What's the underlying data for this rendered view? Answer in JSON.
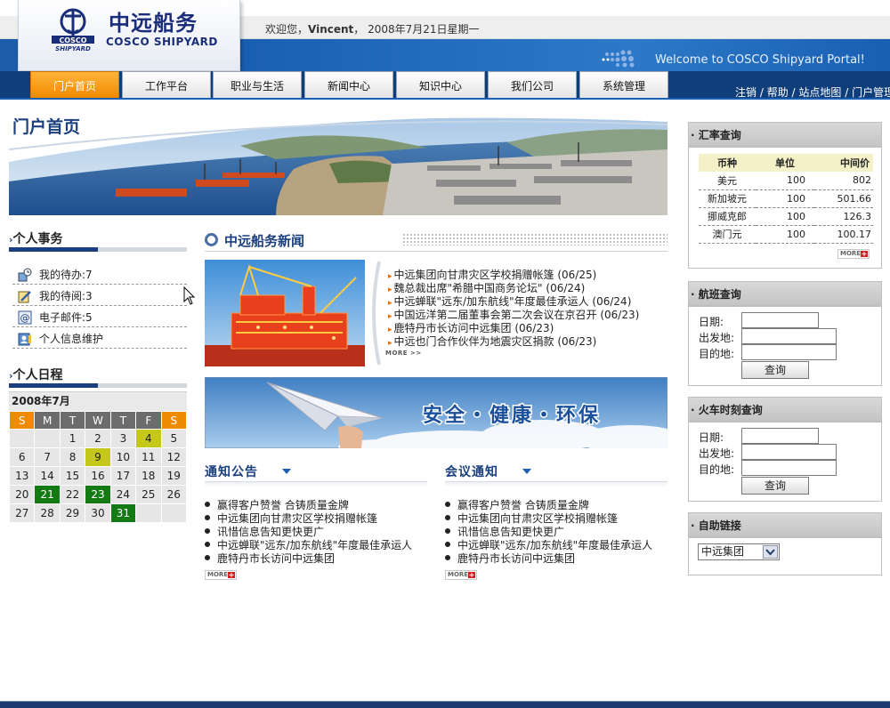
{
  "header": {
    "logo_cn": "中远船务",
    "logo_en": "COSCO SHIPYARD",
    "welcome_prefix": "欢迎您，",
    "user": "Vincent",
    "welcome_suffix": "，  2008年7月21日星期一",
    "portal_message": "Welcome to COSCO Shipyard Portal!"
  },
  "nav": {
    "tabs": [
      "门户首页",
      "工作平台",
      "职业与生活",
      "新闻中心",
      "知识中心",
      "我们公司",
      "系统管理"
    ],
    "links": [
      "注销",
      "帮助",
      "站点地图",
      "门户管理"
    ],
    "sep": " / "
  },
  "page_title": "门户首页",
  "personal": {
    "title": "个人事务",
    "items": [
      "我的待办:7",
      "我的待阅:3",
      "电子邮件:5",
      "个人信息维护"
    ]
  },
  "schedule": {
    "title": "个人日程",
    "month": "2008年7月",
    "weekdays": [
      "S",
      "M",
      "T",
      "W",
      "T",
      "F",
      "S"
    ],
    "weeks": [
      [
        "",
        "",
        "1",
        "2",
        "3",
        "4",
        "5"
      ],
      [
        "6",
        "7",
        "8",
        "9",
        "10",
        "11",
        "12"
      ],
      [
        "13",
        "14",
        "15",
        "16",
        "17",
        "18",
        "19"
      ],
      [
        "20",
        "21",
        "22",
        "23",
        "24",
        "25",
        "26"
      ],
      [
        "27",
        "28",
        "29",
        "30",
        "31",
        "",
        ""
      ]
    ]
  },
  "news": {
    "title": "中远船务新闻",
    "items": [
      "中远集团向甘肃灾区学校捐赠帐篷 (06/25)",
      "魏总裁出席\"希腊中国商务论坛\" (06/24)",
      "中远蝉联\"远东/加东航线\"年度最佳承运人 (06/24)",
      "中国远洋第二届董事会第二次会议在京召开 (06/23)",
      "鹿特丹市长访问中远集团 (06/23)",
      "中远也门合作伙伴为地震灾区捐款 (06/23)"
    ],
    "more": "MORE >>"
  },
  "safety_banner": "安全・健康・环保",
  "notices": {
    "title": "通知公告",
    "items": [
      "赢得客户赞誉 合铸质量金牌",
      "中远集团向甘肃灾区学校捐赠帐篷",
      "讯惜信息告知更快更广",
      "中远蝉联\"远东/加东航线\"年度最佳承运人",
      "鹿特丹市长访问中远集团"
    ],
    "more": "MORE"
  },
  "meetings": {
    "title": "会议通知",
    "items": [
      "赢得客户赞誉 合铸质量金牌",
      "中远集团向甘肃灾区学校捐赠帐篷",
      "讯惜信息告知更快更广",
      "中远蝉联\"远东/加东航线\"年度最佳承运人",
      "鹿特丹市长访问中远集团"
    ],
    "more": "MORE"
  },
  "rates": {
    "title": "· 汇率查询",
    "headers": [
      "币种",
      "单位",
      "中间价"
    ],
    "rows": [
      [
        "美元",
        "100",
        "802"
      ],
      [
        "新加坡元",
        "100",
        "501.66"
      ],
      [
        "挪威克郎",
        "100",
        "126.3"
      ],
      [
        "澳门元",
        "100",
        "100.17"
      ]
    ],
    "more": "MORE"
  },
  "flight": {
    "title": "· 航班查询",
    "labels": [
      "日期:",
      "出发地:",
      "目的地:"
    ],
    "button": "查询"
  },
  "train": {
    "title": "· 火车时刻查询",
    "labels": [
      "日期:",
      "出发地:",
      "目的地:"
    ],
    "button": "查询"
  },
  "links": {
    "title": "· 自助链接",
    "selected": "中远集团"
  },
  "colors": {
    "brand_blue": "#1a5fb2",
    "nav_active": "#f08a00",
    "calendar_highlight": "#c5c81a",
    "calendar_dark": "#137a14"
  }
}
